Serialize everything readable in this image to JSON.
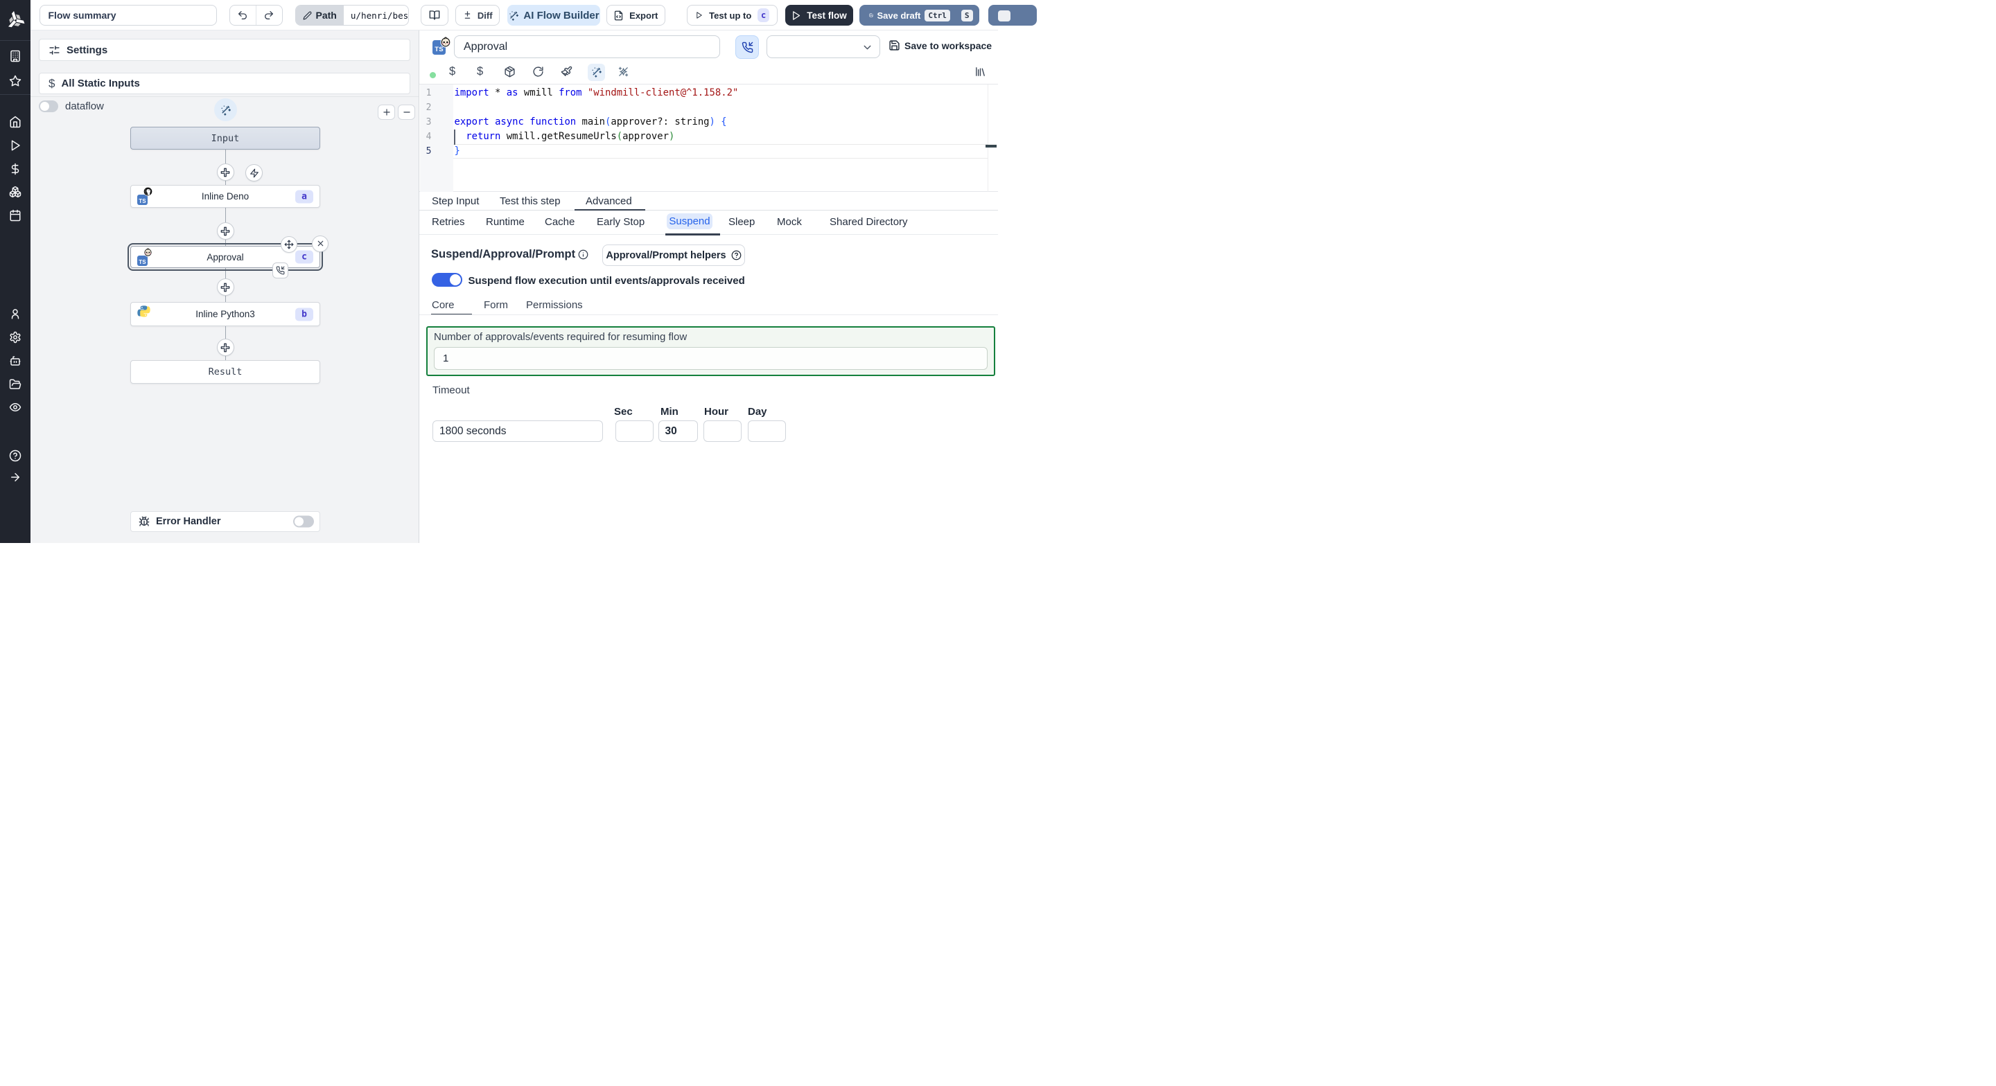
{
  "topbar": {
    "flow_summary": "Flow summary",
    "path_label": "Path",
    "path_value": "u/henri/bes",
    "diff_label": "Diff",
    "ai_label": "AI Flow Builder",
    "export_label": "Export",
    "test_up_to_label": "Test up to",
    "test_up_to_badge": "c",
    "test_flow_label": "Test flow",
    "save_draft_label": "Save draft",
    "kbd_ctrl": "Ctrl",
    "kbd_s": "S"
  },
  "flow_panel": {
    "settings_label": "Settings",
    "static_inputs_label": "All Static Inputs",
    "dataflow_label": "dataflow",
    "zoom_in": "+",
    "zoom_out": "−",
    "nodes": {
      "input": "Input",
      "deno_label": "Inline Deno",
      "deno_badge": "a",
      "approval_label": "Approval",
      "approval_badge": "c",
      "python_label": "Inline Python3",
      "python_badge": "b",
      "result": "Result"
    },
    "error_handler_label": "Error Handler"
  },
  "step_header": {
    "name_value": "Approval",
    "save_label": "Save to workspace"
  },
  "code": {
    "numbers": [
      "1",
      "2",
      "3",
      "4",
      "5"
    ],
    "lines": [
      [
        [
          "kw",
          "import"
        ],
        [
          "pl",
          " * "
        ],
        [
          "kw",
          "as"
        ],
        [
          "pl",
          " wmill "
        ],
        [
          "kw",
          "from"
        ],
        [
          "pl",
          " "
        ],
        [
          "str",
          "\"windmill-client@^1.158.2\""
        ]
      ],
      [],
      [
        [
          "kw",
          "export"
        ],
        [
          "pl",
          " "
        ],
        [
          "kw",
          "async"
        ],
        [
          "pl",
          " "
        ],
        [
          "kw",
          "function"
        ],
        [
          "pl",
          " main"
        ],
        [
          "pb",
          "("
        ],
        [
          "pl",
          "approver?: string"
        ],
        [
          "pb",
          ")"
        ],
        [
          "pl",
          " "
        ],
        [
          "pb",
          "{"
        ]
      ],
      [
        [
          "pl",
          "  "
        ],
        [
          "kw",
          "return"
        ],
        [
          "pl",
          " wmill.getResumeUrls"
        ],
        [
          "pg",
          "("
        ],
        [
          "pl",
          "approver"
        ],
        [
          "pg",
          ")"
        ]
      ],
      [
        [
          "pb",
          "}"
        ]
      ]
    ]
  },
  "tabs": {
    "main": [
      "Step Input",
      "Test this step",
      "Advanced"
    ],
    "advanced": [
      "Retries",
      "Runtime",
      "Cache",
      "Early Stop",
      "Suspend",
      "Sleep",
      "Mock",
      "Shared Directory"
    ]
  },
  "suspend": {
    "title": "Suspend/Approval/Prompt",
    "helpers_label": "Approval/Prompt helpers",
    "toggle_label": "Suspend flow execution until events/approvals received",
    "tabs": [
      "Core",
      "Form",
      "Permissions"
    ],
    "approvals_label": "Number of approvals/events required for resuming flow",
    "approvals_value": "1",
    "timeout_label": "Timeout",
    "timeout_value": "1800 seconds",
    "sec_label": "Sec",
    "min_label": "Min",
    "hour_label": "Hour",
    "day_label": "Day",
    "min_value": "30"
  }
}
